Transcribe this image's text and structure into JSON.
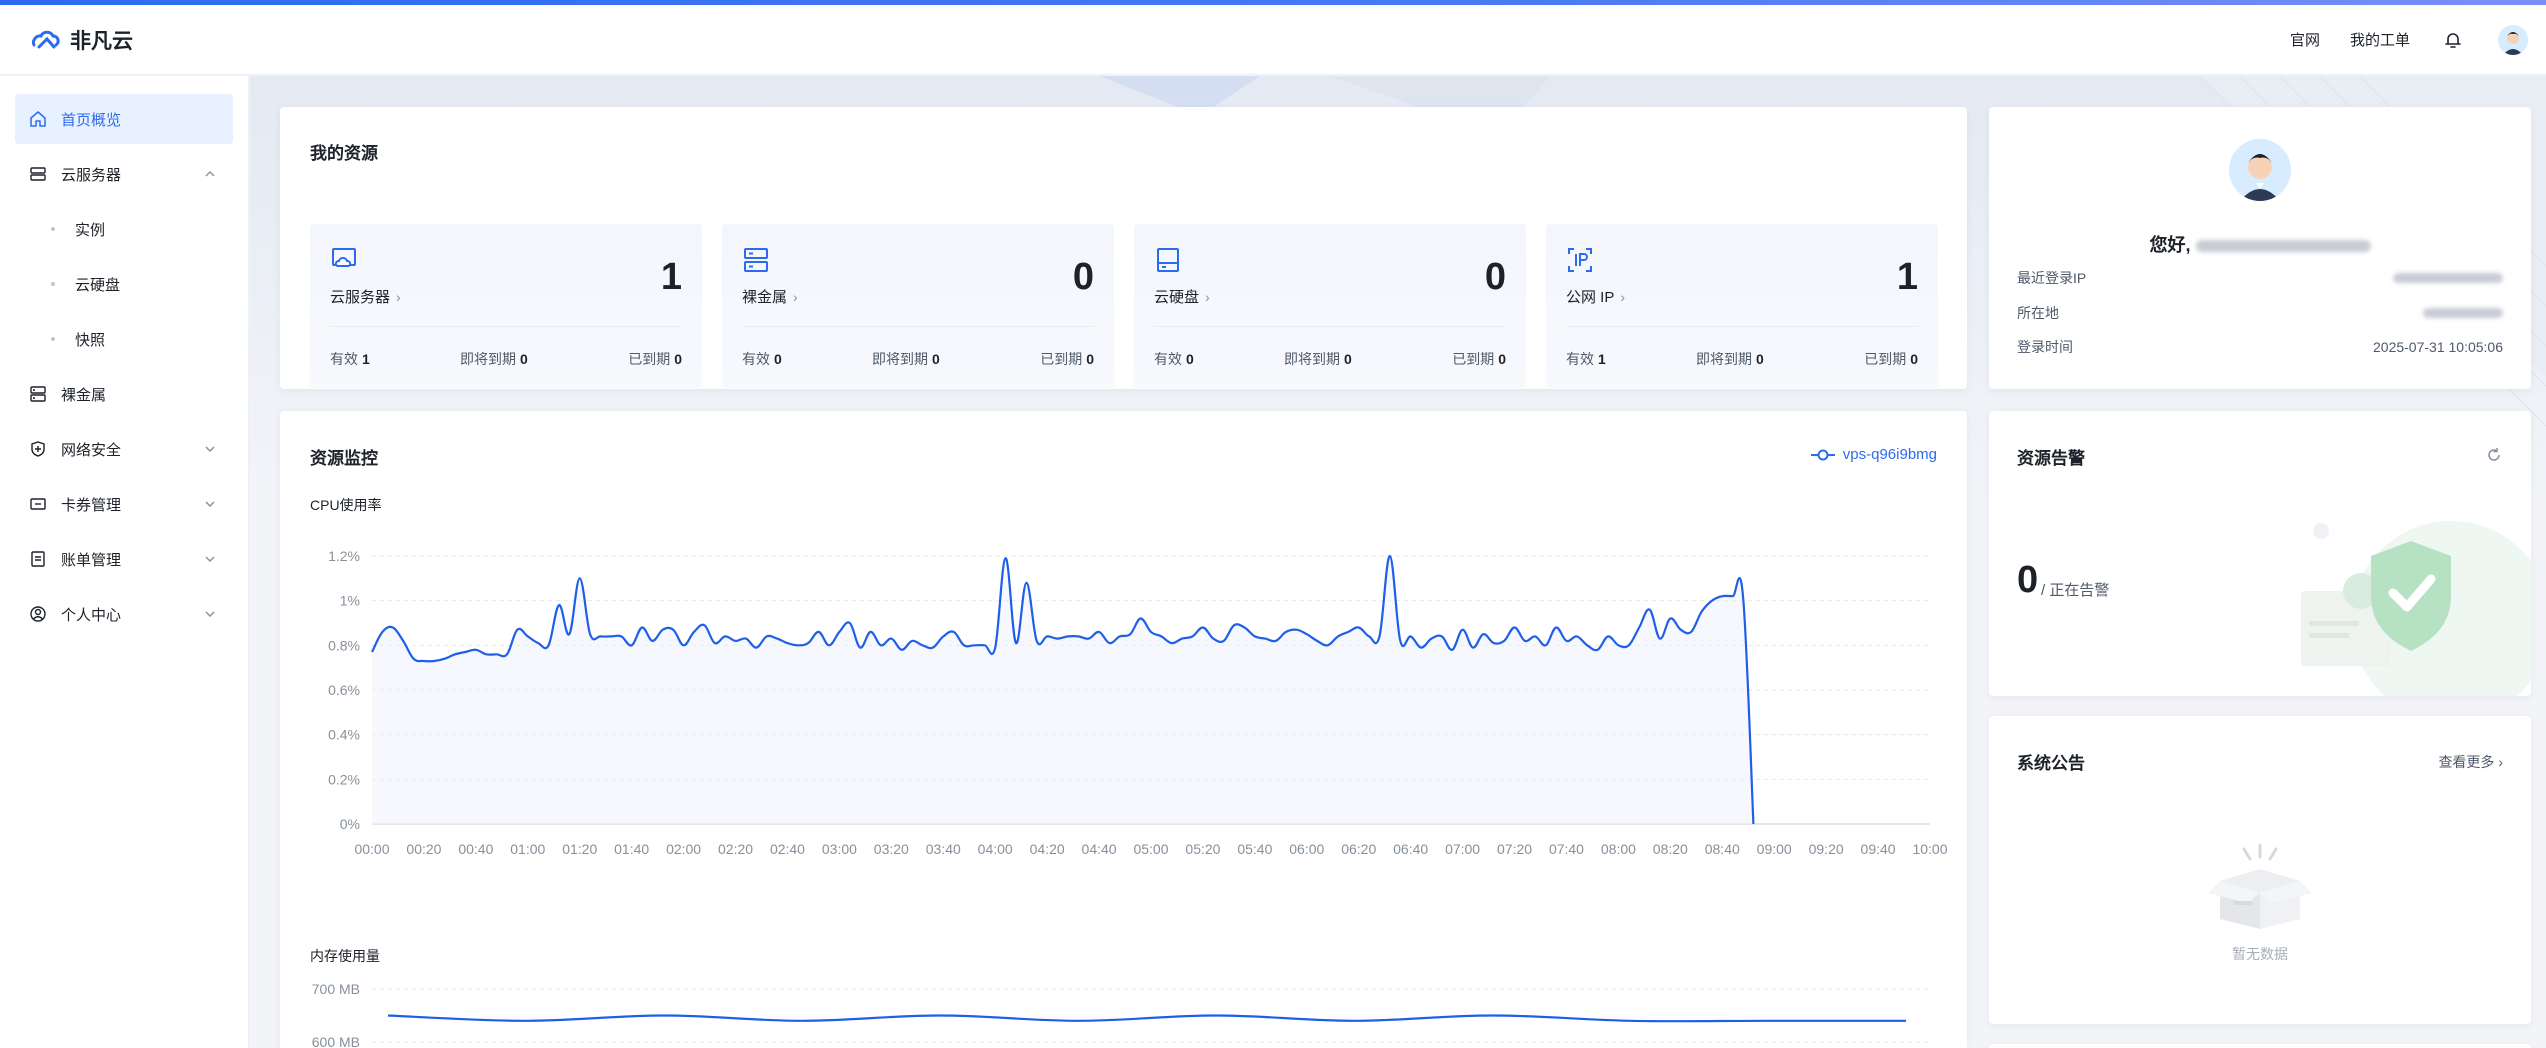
{
  "brand": {
    "name": "非凡云"
  },
  "header": {
    "official_site": "官网",
    "my_tickets": "我的工单"
  },
  "sidebar": {
    "items": [
      {
        "label": "首页概览",
        "icon": "home-icon",
        "active": true
      },
      {
        "label": "云服务器",
        "icon": "cloud-server-icon",
        "expanded": true
      },
      {
        "label": "实例",
        "sub": true
      },
      {
        "label": "云硬盘",
        "sub": true
      },
      {
        "label": "快照",
        "sub": true
      },
      {
        "label": "裸金属",
        "icon": "bare-metal-icon"
      },
      {
        "label": "网络安全",
        "icon": "shield-icon",
        "expandable": true
      },
      {
        "label": "卡券管理",
        "icon": "ticket-icon",
        "expandable": true
      },
      {
        "label": "账单管理",
        "icon": "bill-icon",
        "expandable": true
      },
      {
        "label": "个人中心",
        "icon": "user-icon",
        "expandable": true
      }
    ]
  },
  "resources": {
    "title": "我的资源",
    "tiles": [
      {
        "name": "云服务器",
        "count": "1",
        "valid_label": "有效",
        "valid": "1",
        "expiring_label": "即将到期",
        "expiring": "0",
        "expired_label": "已到期",
        "expired": "0",
        "icon": "cloud-server-icon"
      },
      {
        "name": "裸金属",
        "count": "0",
        "valid_label": "有效",
        "valid": "0",
        "expiring_label": "即将到期",
        "expiring": "0",
        "expired_label": "已到期",
        "expired": "0",
        "icon": "bare-metal-icon"
      },
      {
        "name": "云硬盘",
        "count": "0",
        "valid_label": "有效",
        "valid": "0",
        "expiring_label": "即将到期",
        "expiring": "0",
        "expired_label": "已到期",
        "expired": "0",
        "icon": "disk-icon"
      },
      {
        "name": "公网 IP",
        "count": "1",
        "valid_label": "有效",
        "valid": "1",
        "expiring_label": "即将到期",
        "expiring": "0",
        "expired_label": "已到期",
        "expired": "0",
        "icon": "ip-icon"
      }
    ]
  },
  "profile": {
    "greeting": "您好,",
    "last_login_ip_label": "最近登录IP",
    "location_label": "所在地",
    "login_time_label": "登录时间",
    "login_time": "2025-07-31 10:05:06"
  },
  "monitor": {
    "title": "资源监控",
    "instance": "vps-q96i9bmg",
    "cpu_label": "CPU使用率",
    "mem_label": "内存使用量"
  },
  "alarm": {
    "title": "资源告警",
    "count": "0",
    "sub": "/ 正在告警"
  },
  "notice": {
    "title": "系统公告",
    "more": "查看更多",
    "empty": "暂无数据"
  },
  "colors": {
    "accent": "#2c6bf1",
    "line": "#1f5fe8"
  },
  "chart_data": [
    {
      "type": "line",
      "title": "CPU使用率",
      "y_unit": "%",
      "ylim": [
        0,
        1.2
      ],
      "y_ticks": [
        "0%",
        "0.2%",
        "0.4%",
        "0.6%",
        "0.8%",
        "1%",
        "1.2%"
      ],
      "x_ticks": [
        "00:00",
        "00:20",
        "00:40",
        "01:00",
        "01:20",
        "01:40",
        "02:00",
        "02:20",
        "02:40",
        "03:00",
        "03:20",
        "03:40",
        "04:00",
        "04:20",
        "04:40",
        "05:00",
        "05:20",
        "05:40",
        "06:00",
        "06:20",
        "06:40",
        "07:00",
        "07:20",
        "07:40",
        "08:00",
        "08:20",
        "08:40",
        "09:00",
        "09:20",
        "09:40",
        "10:00"
      ],
      "x_minutes": [
        0,
        4,
        8,
        12,
        16,
        20,
        24,
        28,
        32,
        36,
        40,
        44,
        48,
        52,
        56,
        60,
        64,
        68,
        72,
        76,
        80,
        84,
        88,
        92,
        96,
        100,
        104,
        108,
        112,
        116,
        120,
        124,
        128,
        132,
        136,
        140,
        144,
        148,
        152,
        156,
        160,
        164,
        168,
        172,
        176,
        180,
        184,
        188,
        192,
        196,
        200,
        204,
        208,
        212,
        216,
        220,
        224,
        228,
        232,
        236,
        240,
        244,
        248,
        252,
        256,
        260,
        264,
        268,
        272,
        276,
        280,
        284,
        288,
        292,
        296,
        300,
        304,
        308,
        312,
        316,
        320,
        324,
        328,
        332,
        336,
        340,
        344,
        348,
        352,
        356,
        360,
        364,
        368,
        372,
        376,
        380,
        384,
        388,
        392,
        396,
        400,
        404,
        408,
        412,
        416,
        420,
        424,
        428,
        432,
        436,
        440,
        444,
        448,
        452,
        456,
        460,
        464,
        468,
        472,
        476,
        480,
        484,
        488,
        492,
        496,
        500,
        504,
        508,
        512,
        516,
        520,
        524,
        528,
        532,
        536,
        540,
        544,
        548,
        552,
        556,
        560,
        564,
        568,
        572,
        576,
        580,
        584,
        588,
        592,
        596,
        600,
        604,
        604.5
      ],
      "series": [
        {
          "values": [
            0.77,
            0.86,
            0.88,
            0.82,
            0.74,
            0.73,
            0.73,
            0.74,
            0.76,
            0.77,
            0.78,
            0.76,
            0.76,
            0.76,
            0.87,
            0.84,
            0.81,
            0.8,
            0.98,
            0.85,
            1.1,
            0.85,
            0.84,
            0.84,
            0.84,
            0.8,
            0.88,
            0.82,
            0.87,
            0.87,
            0.8,
            0.86,
            0.89,
            0.81,
            0.84,
            0.82,
            0.83,
            0.79,
            0.84,
            0.83,
            0.81,
            0.8,
            0.81,
            0.86,
            0.8,
            0.86,
            0.9,
            0.79,
            0.86,
            0.8,
            0.83,
            0.78,
            0.82,
            0.8,
            0.79,
            0.84,
            0.86,
            0.8,
            0.8,
            0.8,
            0.79,
            1.19,
            0.81,
            1.08,
            0.82,
            0.84,
            0.83,
            0.84,
            0.84,
            0.83,
            0.86,
            0.81,
            0.84,
            0.85,
            0.92,
            0.86,
            0.84,
            0.81,
            0.83,
            0.84,
            0.88,
            0.83,
            0.82,
            0.89,
            0.88,
            0.84,
            0.83,
            0.82,
            0.86,
            0.87,
            0.85,
            0.82,
            0.8,
            0.84,
            0.86,
            0.88,
            0.84,
            0.84,
            1.2,
            0.82,
            0.84,
            0.79,
            0.83,
            0.84,
            0.78,
            0.87,
            0.79,
            0.85,
            0.81,
            0.82,
            0.88,
            0.82,
            0.84,
            0.8,
            0.88,
            0.82,
            0.84,
            0.8,
            0.78,
            0.84,
            0.8,
            0.8,
            0.88,
            0.96,
            0.83,
            0.92,
            0.87,
            0.86,
            0.95,
            1.0,
            1.02,
            1.02,
            1.02,
            0.0
          ]
        }
      ]
    },
    {
      "type": "line",
      "title": "内存使用量",
      "y_ticks_visible": [
        "700 MB",
        "600 MB"
      ],
      "series": [
        {
          "values": [
            605,
            604,
            605,
            604,
            605,
            604,
            605,
            604,
            605,
            604,
            604,
            604
          ]
        }
      ]
    }
  ]
}
